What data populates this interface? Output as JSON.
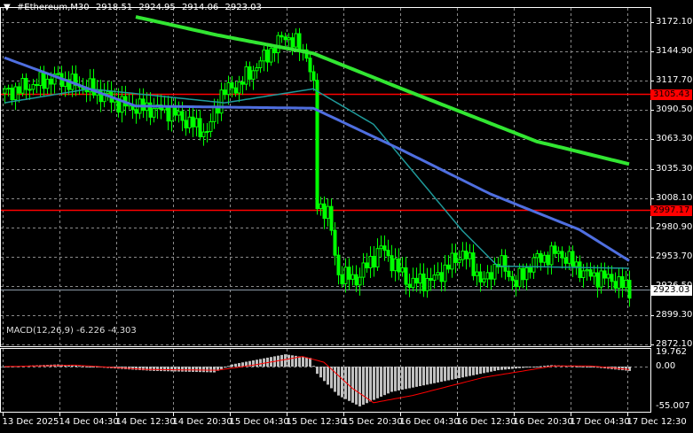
{
  "header": {
    "menu_icon": "triangle-down-icon",
    "symbol": "#Ethereum,M30",
    "open": "2918.51",
    "high": "2924.95",
    "low": "2914.06",
    "close": "2923.03"
  },
  "price_axis": {
    "ticks": [
      "3172.10",
      "3144.90",
      "3117.70",
      "3090.50",
      "3063.30",
      "3035.30",
      "3008.10",
      "2980.90",
      "2953.70",
      "2926.50",
      "2899.30",
      "2872.10"
    ],
    "ticks_values": [
      3172.1,
      3144.9,
      3117.7,
      3090.5,
      3063.3,
      3035.3,
      3008.1,
      2980.9,
      2953.7,
      2926.5,
      2899.3,
      2872.1
    ],
    "levels": [
      {
        "label": "3105.43",
        "value": 3105.43,
        "color": "#ff0000"
      },
      {
        "label": "2997.17",
        "value": 2997.17,
        "color": "#ff0000"
      }
    ],
    "current": {
      "label": "2923.03",
      "value": 2923.03,
      "color": "#8c9aa8"
    }
  },
  "macd": {
    "label": "MACD(12,26,9) -6.226 -4.303",
    "ticks": [
      "19.762",
      "0.00",
      "-55.007"
    ],
    "ticks_values": [
      19.762,
      0,
      -55.007
    ]
  },
  "time_axis": [
    "13 Dec 2025",
    "14 Dec 04:30",
    "14 Dec 12:30",
    "14 Dec 20:30",
    "15 Dec 04:30",
    "15 Dec 12:30",
    "15 Dec 20:30",
    "16 Dec 04:30",
    "16 Dec 12:30",
    "16 Dec 20:30",
    "17 Dec 04:30",
    "17 Dec 12:30"
  ],
  "colors": {
    "candle": "#00ff00",
    "ma_slow": "#32e632",
    "ma_mid": "#4f6fe0",
    "ma_fast": "#1f9a9a",
    "macd_hist": "#c0c0c0",
    "macd_signal": "#ff0000",
    "grid": "#8a8a8a"
  },
  "chart_data": {
    "type": "line",
    "title": "#Ethereum,M30",
    "bars_per_label": 16,
    "price_path": [
      [
        0,
        3106
      ],
      [
        14,
        3120
      ],
      [
        24,
        3110
      ],
      [
        34,
        3094
      ],
      [
        46,
        3090
      ],
      [
        57,
        3069
      ],
      [
        61,
        3106
      ],
      [
        66,
        3114
      ],
      [
        72,
        3135
      ],
      [
        79,
        3160
      ],
      [
        85,
        3143
      ],
      [
        87,
        3110
      ],
      [
        88,
        3003
      ],
      [
        91,
        2995
      ],
      [
        94,
        2937
      ],
      [
        99,
        2933
      ],
      [
        106,
        2962
      ],
      [
        114,
        2929
      ],
      [
        121,
        2933
      ],
      [
        129,
        2958
      ],
      [
        135,
        2929
      ],
      [
        139,
        2950
      ],
      [
        144,
        2929
      ],
      [
        149,
        2950
      ],
      [
        156,
        2958
      ],
      [
        164,
        2937
      ],
      [
        171,
        2933
      ],
      [
        176,
        2923
      ]
    ],
    "ma_slow": [
      [
        37,
        3177
      ],
      [
        60,
        3160
      ],
      [
        87,
        3143
      ],
      [
        112,
        3110
      ],
      [
        150,
        3061
      ],
      [
        176,
        3040
      ]
    ],
    "ma_mid": [
      [
        0,
        3139
      ],
      [
        37,
        3094
      ],
      [
        87,
        3092
      ],
      [
        112,
        3053
      ],
      [
        137,
        3012
      ],
      [
        162,
        2979
      ],
      [
        176,
        2950
      ]
    ],
    "ma_fast": [
      [
        0,
        3097
      ],
      [
        24,
        3110
      ],
      [
        62,
        3097
      ],
      [
        87,
        3110
      ],
      [
        104,
        3077
      ],
      [
        129,
        2978
      ],
      [
        139,
        2945
      ],
      [
        176,
        2943
      ]
    ],
    "macd_hist": [
      [
        0,
        0
      ],
      [
        15,
        3
      ],
      [
        32,
        -3
      ],
      [
        42,
        -6
      ],
      [
        59,
        -8
      ],
      [
        64,
        3
      ],
      [
        79,
        17
      ],
      [
        86,
        12
      ],
      [
        88,
        -10
      ],
      [
        94,
        -40
      ],
      [
        100,
        -55
      ],
      [
        109,
        -35
      ],
      [
        124,
        -20
      ],
      [
        139,
        -5
      ],
      [
        154,
        2
      ],
      [
        164,
        0
      ],
      [
        176,
        -6
      ]
    ],
    "macd_signal": [
      [
        0,
        0
      ],
      [
        20,
        2
      ],
      [
        40,
        -4
      ],
      [
        60,
        -5
      ],
      [
        70,
        2
      ],
      [
        84,
        14
      ],
      [
        90,
        6
      ],
      [
        98,
        -30
      ],
      [
        104,
        -50
      ],
      [
        115,
        -40
      ],
      [
        135,
        -15
      ],
      [
        155,
        1
      ],
      [
        165,
        1
      ],
      [
        176,
        -4
      ]
    ]
  }
}
